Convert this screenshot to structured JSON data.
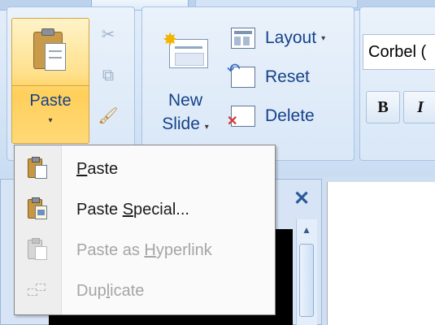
{
  "ribbon": {
    "clipboard": {
      "paste_label": "Paste",
      "paste_caret": "▾"
    },
    "slides": {
      "new_label": "New",
      "slide_label": "Slide",
      "slide_caret": "▾",
      "layout_label": "Layout",
      "layout_caret": "▾",
      "reset_label": "Reset",
      "delete_label": "Delete"
    },
    "font": {
      "font_name": "Corbel (",
      "bold_label": "B",
      "italic_label": "I"
    }
  },
  "panel": {
    "close_glyph": "✕",
    "scroll_up_glyph": "▲"
  },
  "paste_menu": {
    "items": [
      {
        "label_pre": "",
        "label_key": "P",
        "label_post": "aste",
        "enabled": true
      },
      {
        "label_pre": "Paste ",
        "label_key": "S",
        "label_post": "pecial...",
        "enabled": true
      },
      {
        "label_pre": "Paste as ",
        "label_key": "H",
        "label_post": "yperlink",
        "enabled": false
      },
      {
        "label_pre": "Dup",
        "label_key": "l",
        "label_post": "icate",
        "enabled": false
      }
    ]
  },
  "icons": {
    "cut": "✂",
    "copy": "⧉",
    "format_painter": "🖌",
    "new_slide_spark": "✸"
  },
  "colors": {
    "accent_text": "#15428b",
    "hot_button": "#ffd978",
    "disabled_text": "#a5a5a5"
  }
}
